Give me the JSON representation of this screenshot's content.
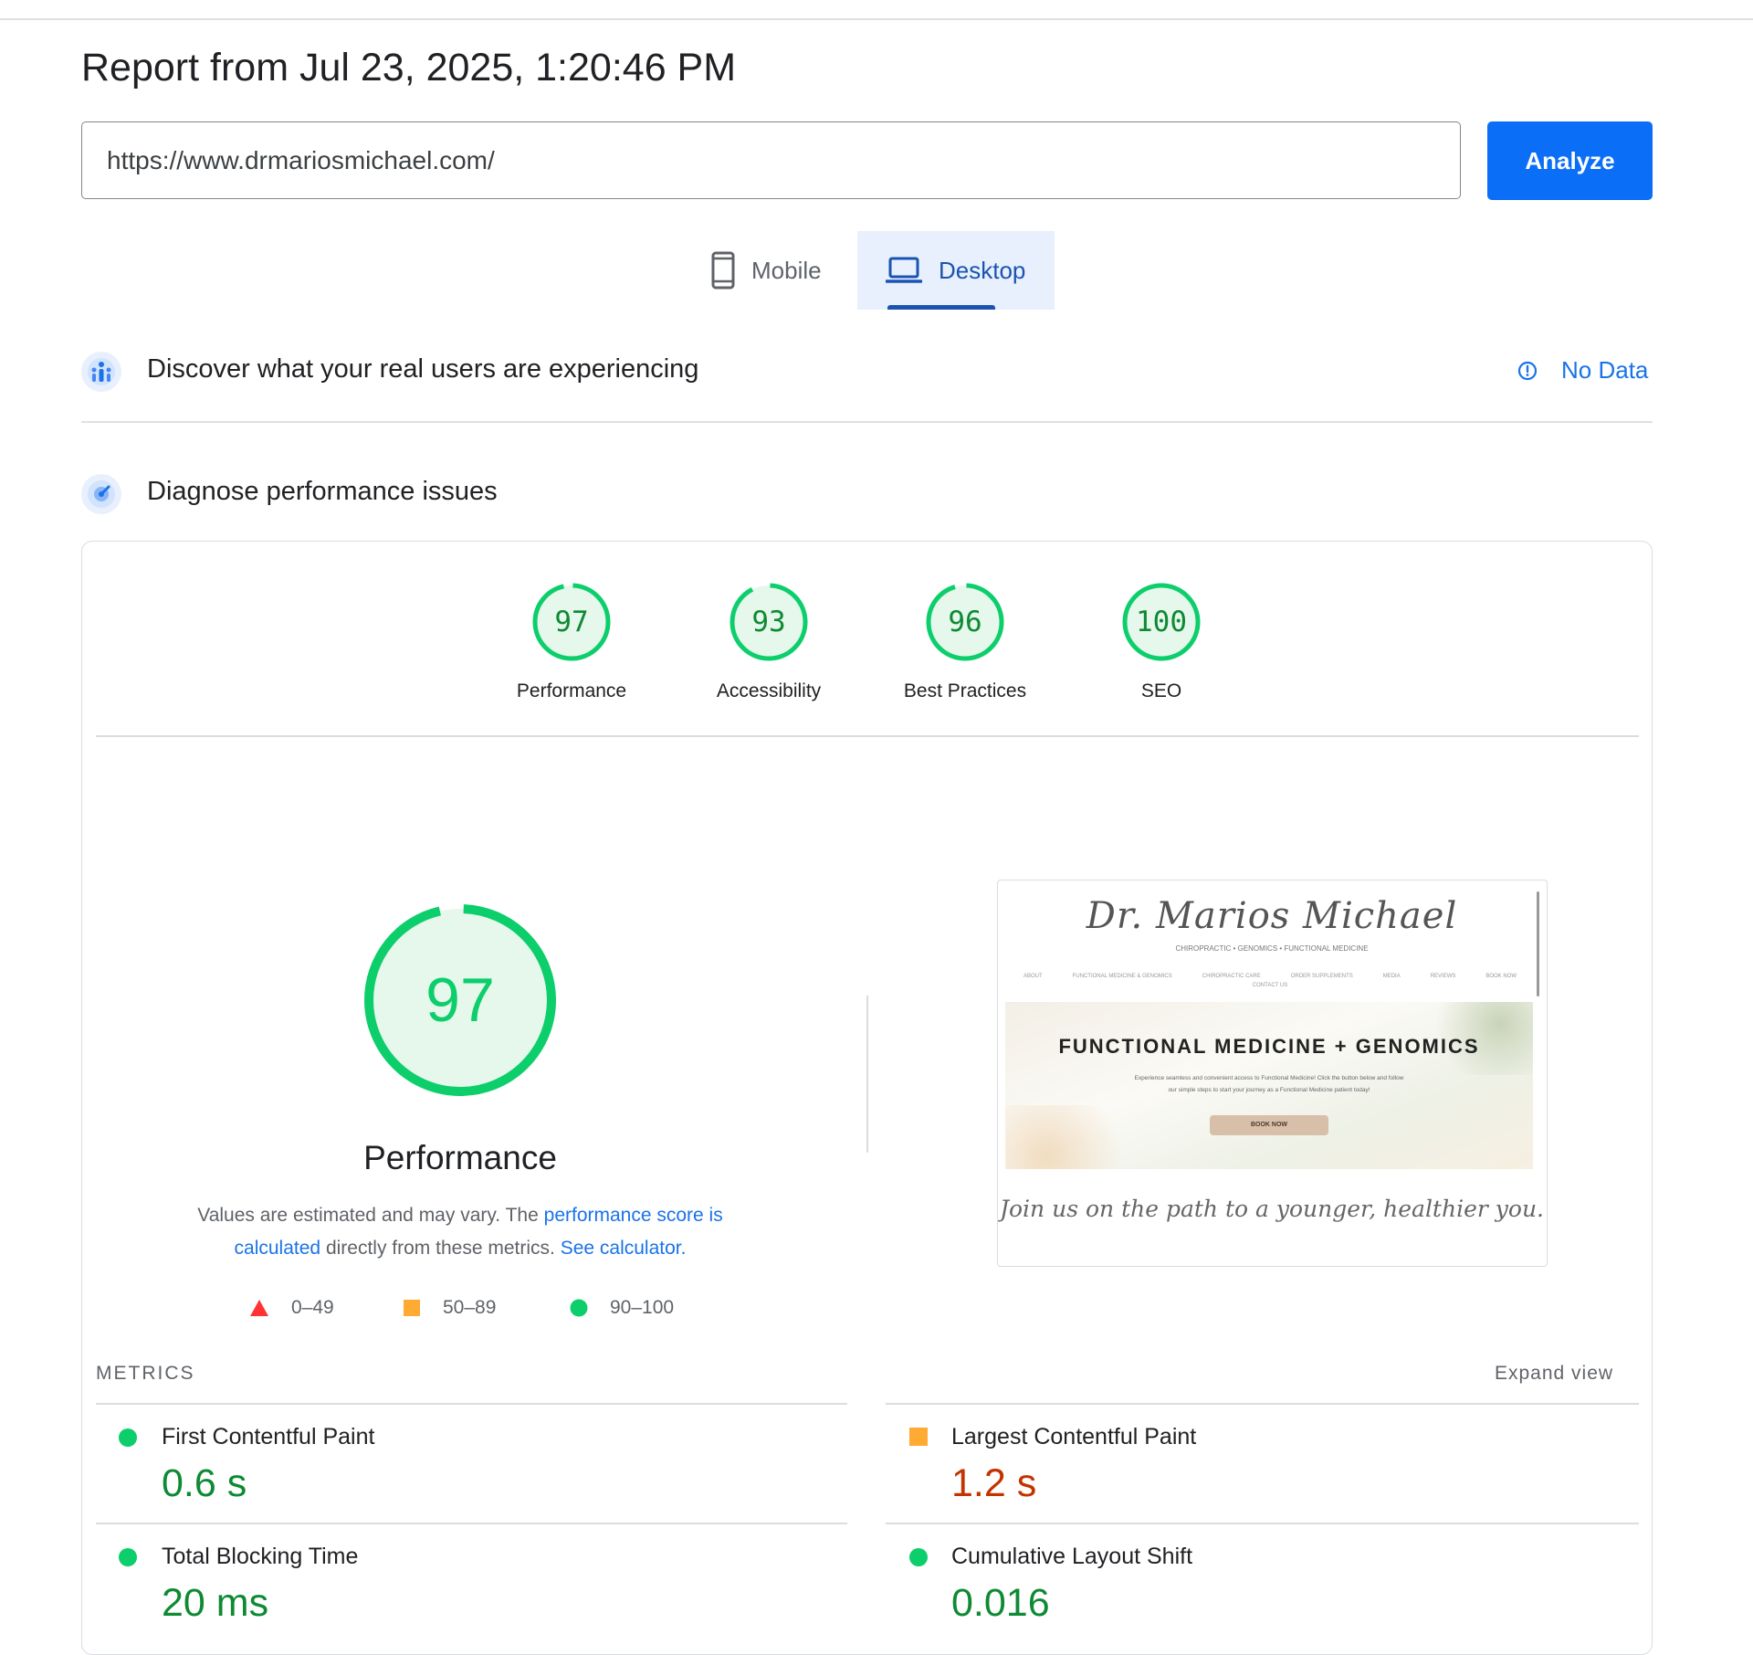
{
  "report": {
    "title": "Report from Jul 23, 2025, 1:20:46 PM"
  },
  "search": {
    "url": "https://www.drmariosmichael.com/",
    "analyze_label": "Analyze"
  },
  "device_tabs": {
    "mobile_label": "Mobile",
    "desktop_label": "Desktop",
    "selected": "desktop"
  },
  "field_section": {
    "title": "Discover what your real users are experiencing",
    "status_label": "No Data"
  },
  "lab_section": {
    "title": "Diagnose performance issues"
  },
  "categories": [
    {
      "label": "Performance",
      "score": 97
    },
    {
      "label": "Accessibility",
      "score": 93
    },
    {
      "label": "Best Practices",
      "score": 96
    },
    {
      "label": "SEO",
      "score": 100
    }
  ],
  "performance": {
    "score": 97,
    "title": "Performance",
    "desc_prefix": "Values are estimated and may vary. The",
    "desc_link1": "performance score is calculated",
    "desc_middle": "directly from these metrics.",
    "desc_link2": "See calculator."
  },
  "legend": [
    {
      "shape": "triangle",
      "color": "#ff3333",
      "label": "0–49"
    },
    {
      "shape": "square",
      "color": "#ffaa33",
      "label": "50–89"
    },
    {
      "shape": "circle",
      "color": "#0cce6b",
      "label": "90–100"
    }
  ],
  "screenshot": {
    "logo_text": "Dr. Marios Michael",
    "logo_sub": "CHIROPRACTIC • GENOMICS • FUNCTIONAL MEDICINE",
    "nav": [
      "ABOUT",
      "FUNCTIONAL MEDICINE & GENOMICS",
      "CHIROPRACTIC CARE",
      "ORDER SUPPLEMENTS",
      "MEDIA",
      "REVIEWS",
      "BOOK NOW",
      "CONTACT US"
    ],
    "hero_title": "FUNCTIONAL MEDICINE + GENOMICS",
    "hero_text_1": "Experience seamless and convenient access to Functional Medicine! Click the button below and follow",
    "hero_text_2": "our simple steps to start your journey as a Functional Medicine patient today!",
    "hero_button": "BOOK NOW",
    "tagline": "Join us on the path to a younger, healthier you."
  },
  "metrics": {
    "heading": "METRICS",
    "expand_label": "Expand view",
    "items": [
      {
        "label": "First Contentful Paint",
        "value": "0.6 s",
        "rating": "good"
      },
      {
        "label": "Largest Contentful Paint",
        "value": "1.2 s",
        "rating": "average"
      },
      {
        "label": "Total Blocking Time",
        "value": "20 ms",
        "rating": "good"
      },
      {
        "label": "Cumulative Layout Shift",
        "value": "0.016",
        "rating": "good"
      }
    ]
  },
  "colors": {
    "good": "#0cce6b",
    "good_text": "#0d8a33",
    "average": "#ffaa33",
    "average_text": "#c33300",
    "poor": "#ff3333",
    "accent": "#1a73e8",
    "analyze_button": "#0b6ef7"
  }
}
